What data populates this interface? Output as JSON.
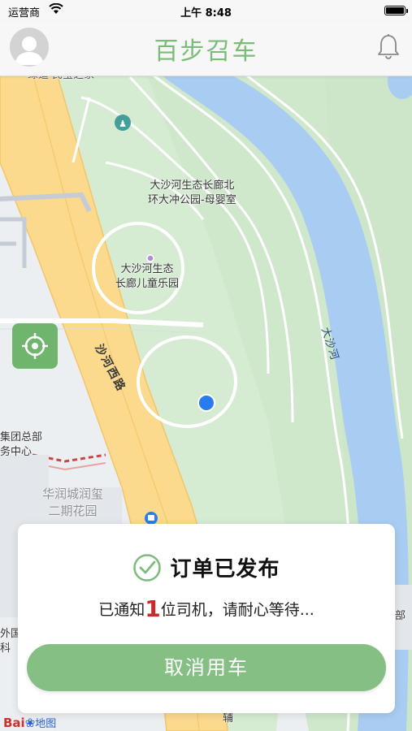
{
  "status_bar": {
    "carrier": "运营商",
    "time": "上午 8:48"
  },
  "nav": {
    "title": "百步召车",
    "avatar_icon": "user-avatar-icon",
    "bell_icon": "bell-icon"
  },
  "map": {
    "labels": {
      "top_cut": "绿道·民宝之家",
      "park_north": "大沙河生态长廊北\n环大冲公园-母婴室",
      "park_kids": "大沙河生态\n长廊儿童乐园",
      "road": "沙河西路",
      "river": "大沙河",
      "group_hq": "集团总部\n务中心",
      "huarun": "华润城润玺\n二期花园",
      "left_edge": "外国\n科",
      "right_edge": "部",
      "bottom_road": "辅"
    },
    "logo_text": "Bai",
    "logo_map": "地图",
    "colors": {
      "park": "#cfe8cc",
      "river": "#a9cdf2",
      "road": "#fbd98d",
      "location_dot": "#2a7af0"
    }
  },
  "order_card": {
    "title": "订单已发布",
    "msg_prefix": "已通知",
    "driver_count": "1",
    "msg_suffix": "位司机，请耐心等待...",
    "cancel_label": "取消用车",
    "accent": "#86bf84"
  }
}
